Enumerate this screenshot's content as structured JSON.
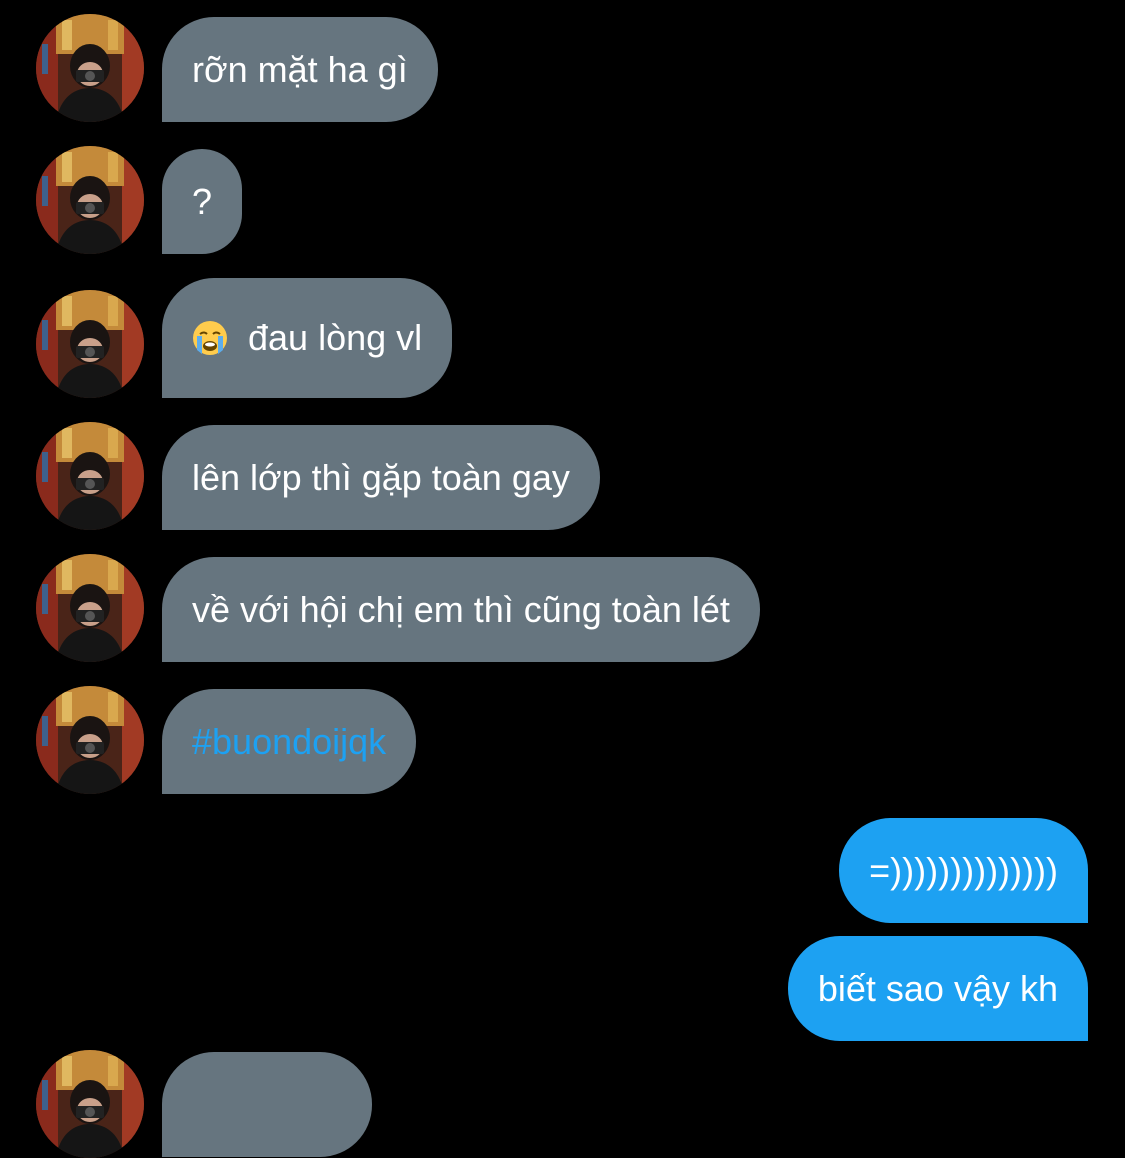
{
  "conversation": {
    "messages": [
      {
        "direction": "incoming",
        "text": "rỡn mặt ha gì"
      },
      {
        "direction": "incoming",
        "text": "?"
      },
      {
        "direction": "incoming",
        "emoji": "loudly-crying-face-emoji",
        "text": "đau lòng vl"
      },
      {
        "direction": "incoming",
        "text": "lên lớp thì gặp toàn gay"
      },
      {
        "direction": "incoming",
        "text": "về với hội chị em thì cũng toàn lét"
      },
      {
        "direction": "incoming",
        "text": "#buondoijqk"
      },
      {
        "direction": "outgoing",
        "text": "=))))))))))))))"
      },
      {
        "direction": "outgoing",
        "text": "biết sao vậy kh"
      }
    ]
  },
  "colors": {
    "background": "#000000",
    "incoming_bubble": "#66757f",
    "outgoing_bubble": "#1da1f2",
    "hashtag": "#1da1f2",
    "text": "#ffffff"
  }
}
